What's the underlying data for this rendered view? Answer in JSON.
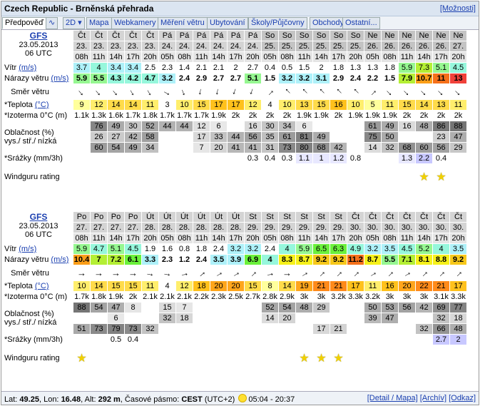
{
  "header": {
    "title": "Czech Republic - Brněnská přehrada",
    "more_link": "[Možnosti]"
  },
  "tabs": [
    "Předpověď",
    "∿",
    "2D ▾",
    "Mapa",
    "Webkamery",
    "Měření větru",
    "Ubytování",
    "Školy/Půjčovny",
    "Obchody",
    "Ostatní..."
  ],
  "info": {
    "model": "GFS",
    "date": "23.05.2013",
    "utc": "06 UTC"
  },
  "labels": {
    "wind": "Vítr",
    "wind_unit": "(m/s)",
    "gust": "Nárazy větru",
    "gust_unit": "(m/s)",
    "dir": "Směr větru",
    "temp": "*Teplota",
    "temp_unit": "(°C)",
    "iso": "*Izoterma 0°C (m)",
    "cloud1": "Oblačnost (%)",
    "cloud2": "vys./ stř./ nízká",
    "precip": "*Srážky (mm/3h)",
    "rating": "Windguru rating"
  },
  "block1": {
    "days": [
      "Čt",
      "Čt",
      "Čt",
      "Čt",
      "Čt",
      "Pá",
      "Pá",
      "Pá",
      "Pá",
      "Pá",
      "Pá",
      "So",
      "So",
      "So",
      "So",
      "So",
      "So",
      "Ne",
      "Ne",
      "Ne",
      "Ne",
      "Ne",
      "Ne"
    ],
    "dates": [
      "23.",
      "23.",
      "23.",
      "23.",
      "23.",
      "24.",
      "24.",
      "24.",
      "24.",
      "24.",
      "24.",
      "25.",
      "25.",
      "25.",
      "25.",
      "25.",
      "25.",
      "26.",
      "26.",
      "26.",
      "26.",
      "26.",
      "27."
    ],
    "hours": [
      "08h",
      "11h",
      "14h",
      "17h",
      "20h",
      "05h",
      "08h",
      "11h",
      "14h",
      "17h",
      "20h",
      "05h",
      "08h",
      "11h",
      "14h",
      "17h",
      "20h",
      "05h",
      "08h",
      "11h",
      "14h",
      "17h",
      "20h"
    ],
    "wind": [
      "3.7",
      "4",
      "3.4",
      "3.4",
      "2.5",
      "2.3",
      "1.4",
      "2.1",
      "2.1",
      "2",
      "2.7",
      "0.4",
      "0.5",
      "1.5",
      "2",
      "1.8",
      "1.3",
      "1.3",
      "1.8",
      "5.9",
      "7.3",
      "5.1",
      "4.5"
    ],
    "gust": [
      "5.9",
      "5.5",
      "4.3",
      "4.2",
      "4.7",
      "3.2",
      "2.4",
      "2.9",
      "2.7",
      "2.7",
      "5.1",
      "1.5",
      "3.2",
      "3.2",
      "3.1",
      "2.9",
      "2.4",
      "2.2",
      "1.5",
      "7.9",
      "10.7",
      "11",
      "13"
    ],
    "dir": [
      140,
      140,
      140,
      150,
      150,
      120,
      160,
      190,
      190,
      200,
      200,
      45,
      315,
      315,
      315,
      315,
      315,
      45,
      135,
      135,
      135,
      135,
      135
    ],
    "temp": [
      "9",
      "12",
      "14",
      "14",
      "11",
      "3",
      "10",
      "15",
      "17",
      "17",
      "12",
      "4",
      "10",
      "13",
      "15",
      "16",
      "10",
      "5",
      "11",
      "15",
      "14",
      "13",
      "11",
      "6"
    ],
    "iso": [
      "1.1k",
      "1.3k",
      "1.6k",
      "1.7k",
      "1.8k",
      "1.7k",
      "1.7k",
      "1.7k",
      "1.9k",
      "2k",
      "2k",
      "2k",
      "2k",
      "1.9k",
      "1.9k",
      "2k",
      "1.9k",
      "1.9k",
      "1.9k",
      "2k",
      "2k",
      "2k",
      "2k"
    ],
    "cloud_high": [
      "",
      "76",
      "49",
      "30",
      "52",
      "44",
      "44",
      "12",
      "6",
      "",
      "16",
      "30",
      "34",
      "6",
      "",
      "",
      "",
      "61",
      "49",
      "16",
      "48",
      "86",
      "88",
      "96"
    ],
    "cloud_mid": [
      "",
      "26",
      "27",
      "42",
      "58",
      "",
      "",
      "17",
      "33",
      "44",
      "56",
      "35",
      "61",
      "81",
      "49",
      "",
      "",
      "75",
      "50",
      "",
      "",
      "23",
      "47",
      ""
    ],
    "cloud_low": [
      "",
      "60",
      "54",
      "49",
      "34",
      "",
      "",
      "7",
      "20",
      "41",
      "41",
      "31",
      "73",
      "80",
      "68",
      "42",
      "",
      "14",
      "32",
      "68",
      "60",
      "56",
      "29"
    ],
    "precip": [
      "",
      "",
      "",
      "",
      "",
      "",
      "",
      "",
      "",
      "",
      "0.3",
      "0.4",
      "0.3",
      "1.1",
      "1",
      "1.2",
      "0.8",
      "",
      "",
      "1.3",
      "2.2",
      "0.4",
      ""
    ],
    "rating": [
      0,
      0,
      0,
      0,
      0,
      0,
      0,
      0,
      0,
      0,
      0,
      0,
      0,
      0,
      0,
      0,
      0,
      0,
      0,
      0,
      1,
      1,
      0
    ]
  },
  "block2": {
    "days": [
      "Po",
      "Po",
      "Po",
      "Po",
      "Út",
      "Út",
      "Út",
      "Út",
      "Út",
      "Út",
      "St",
      "St",
      "St",
      "St",
      "St",
      "St",
      "Čt",
      "Čt",
      "Čt",
      "Čt",
      "Čt",
      "Čt",
      "Čt"
    ],
    "dates": [
      "27.",
      "27.",
      "27.",
      "27.",
      "28.",
      "28.",
      "28.",
      "28.",
      "28.",
      "28.",
      "29.",
      "29.",
      "29.",
      "29.",
      "29.",
      "29.",
      "30.",
      "30.",
      "30.",
      "30.",
      "30.",
      "30.",
      "30."
    ],
    "hours": [
      "08h",
      "11h",
      "14h",
      "17h",
      "20h",
      "05h",
      "08h",
      "11h",
      "14h",
      "17h",
      "20h",
      "05h",
      "08h",
      "11h",
      "14h",
      "17h",
      "20h",
      "05h",
      "08h",
      "11h",
      "14h",
      "17h",
      "20h"
    ],
    "wind": [
      "5.9",
      "4.7",
      "5.1",
      "4.5",
      "1.9",
      "1.6",
      "0.8",
      "1.8",
      "2.4",
      "3.2",
      "3.2",
      "2.4",
      "4",
      "5.9",
      "6.5",
      "6.3",
      "4.9",
      "3.2",
      "3.5",
      "4.5",
      "5.2",
      "4",
      "3.5"
    ],
    "gust": [
      "10.4",
      "7",
      "7.2",
      "6.1",
      "3.3",
      "2.3",
      "1.2",
      "2.4",
      "3.5",
      "3.9",
      "6.9",
      "4",
      "8.3",
      "8.7",
      "9.2",
      "9.2",
      "11.2",
      "8.7",
      "5.5",
      "7.1",
      "8.1",
      "8.8",
      "9.2"
    ],
    "dir": [
      90,
      90,
      90,
      90,
      100,
      100,
      80,
      50,
      60,
      60,
      45,
      80,
      90,
      60,
      45,
      45,
      45,
      60,
      45,
      60,
      45,
      45,
      45
    ],
    "temp": [
      "10",
      "14",
      "15",
      "15",
      "11",
      "4",
      "12",
      "18",
      "20",
      "20",
      "15",
      "8",
      "14",
      "19",
      "21",
      "21",
      "17",
      "11",
      "16",
      "20",
      "22",
      "21",
      "17"
    ],
    "iso": [
      "1.7k",
      "1.8k",
      "1.9k",
      "2k",
      "2.1k",
      "2.1k",
      "2.1k",
      "2.2k",
      "2.3k",
      "2.5k",
      "2.7k",
      "2.8k",
      "2.9k",
      "3k",
      "3k",
      "3.2k",
      "3.3k",
      "3.2k",
      "3k",
      "3k",
      "3k",
      "3.1k",
      "3.3k"
    ],
    "cloud_high": [
      "88",
      "54",
      "47",
      "8",
      "",
      "15",
      "7",
      "",
      "",
      "",
      "",
      "52",
      "54",
      "48",
      "29",
      "",
      "",
      "50",
      "53",
      "56",
      "42",
      "69",
      "77"
    ],
    "cloud_mid": [
      "",
      "",
      "6",
      "",
      "",
      "32",
      "18",
      "",
      "",
      "",
      "",
      "14",
      "20",
      "",
      "",
      "",
      "",
      "39",
      "47",
      "",
      "",
      "32",
      "18"
    ],
    "cloud_low": [
      "51",
      "73",
      "79",
      "73",
      "32",
      "",
      "",
      "",
      "",
      "",
      "",
      "",
      "",
      "",
      "17",
      "21",
      "",
      "",
      "",
      "",
      "32",
      "66",
      "48"
    ],
    "precip": [
      "",
      "",
      "0.5",
      "0.4",
      "",
      "",
      "",
      "",
      "",
      "",
      "",
      "",
      "",
      "",
      "",
      "",
      "",
      "",
      "",
      "",
      "",
      "2.7",
      "2"
    ],
    "rating": [
      1,
      0,
      0,
      0,
      0,
      0,
      0,
      0,
      0,
      0,
      0,
      0,
      0,
      1,
      1,
      1,
      0,
      0,
      0,
      0,
      0,
      0,
      0
    ]
  },
  "footer": {
    "lat_label": "Lat:",
    "lat": "49.25",
    "lon_label": "Lon:",
    "lon": "16.48",
    "alt_label": "Alt:",
    "alt": "292 m",
    "tz_label": "Časové pásmo:",
    "tz": "CEST",
    "tz_offset": "(UTC+2)",
    "sun": "05:04 - 20:37",
    "links": [
      "[Detail / Mapa]",
      "[Archív]",
      "[Odkaz]"
    ]
  }
}
